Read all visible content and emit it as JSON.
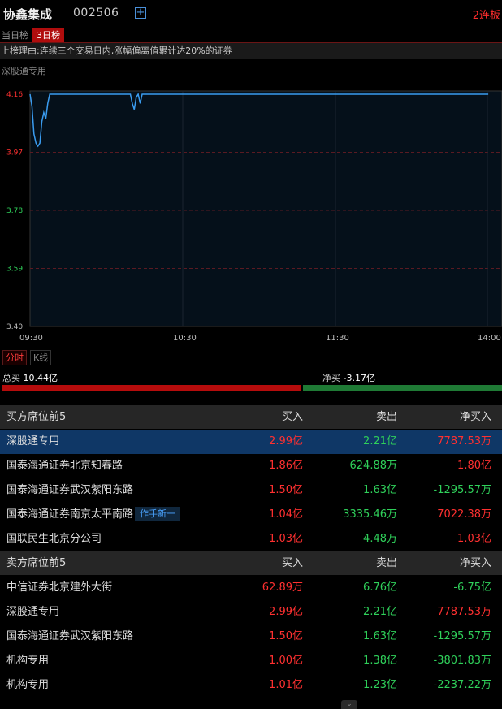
{
  "header": {
    "stock_name": "协鑫集成",
    "stock_code": "002506",
    "add_icon": "plus-square-icon",
    "streak": "2连板"
  },
  "tabs": [
    {
      "label": "当日榜",
      "active": false
    },
    {
      "label": "3日榜",
      "active": true
    }
  ],
  "reason": "上榜理由:连续三个交易日内,涨幅偏离值累计达20%的证券",
  "chart_title": "深股通专用",
  "chart_data": {
    "type": "line",
    "y_ticks": [
      "4.16",
      "3.97",
      "3.78",
      "3.59",
      "3.40"
    ],
    "x_ticks": [
      "09:30",
      "10:30",
      "11:30",
      "14:00"
    ],
    "ylim": [
      3.4,
      4.16
    ],
    "colors": {
      "line": "#3a9cf0",
      "upper": "#ff3030",
      "lower": "#2fd05a",
      "grid": "#5a1a22"
    },
    "series": [
      {
        "values": [
          4.16,
          4.12,
          4.03,
          4.0,
          3.99,
          4.0,
          4.07,
          4.1,
          4.08,
          4.13,
          4.16,
          4.16,
          4.16,
          4.16,
          4.16,
          4.16,
          4.16,
          4.16,
          4.16,
          4.16,
          4.16,
          4.16,
          4.16,
          4.16,
          4.16,
          4.16,
          4.16,
          4.16,
          4.16,
          4.16,
          4.16,
          4.16,
          4.16,
          4.16,
          4.16,
          4.16,
          4.16,
          4.16,
          4.16,
          4.16,
          4.16,
          4.16,
          4.16,
          4.16,
          4.16,
          4.16,
          4.16,
          4.16,
          4.16,
          4.16,
          4.16,
          4.16,
          4.13,
          4.11,
          4.15,
          4.16,
          4.13,
          4.16,
          4.16,
          4.16,
          4.16,
          4.16,
          4.16,
          4.16,
          4.16,
          4.16,
          4.16,
          4.16,
          4.16,
          4.16,
          4.16,
          4.16,
          4.16,
          4.16,
          4.16,
          4.16,
          4.16,
          4.16,
          4.16,
          4.16,
          4.16,
          4.16,
          4.16,
          4.16,
          4.16,
          4.16,
          4.16,
          4.16,
          4.16,
          4.16,
          4.16,
          4.16,
          4.16,
          4.16,
          4.16,
          4.16,
          4.16,
          4.16,
          4.16,
          4.16,
          4.16,
          4.16,
          4.16,
          4.16,
          4.16,
          4.16,
          4.16,
          4.16,
          4.16,
          4.16,
          4.16,
          4.16,
          4.16,
          4.16,
          4.16,
          4.16,
          4.16,
          4.16,
          4.16,
          4.16,
          4.16,
          4.16,
          4.16,
          4.16,
          4.16,
          4.16,
          4.16,
          4.16,
          4.16,
          4.16,
          4.16,
          4.16,
          4.16,
          4.16,
          4.16,
          4.16,
          4.16,
          4.16,
          4.16,
          4.16,
          4.16,
          4.16,
          4.16,
          4.16,
          4.16,
          4.16,
          4.16,
          4.16,
          4.16,
          4.16,
          4.16,
          4.16,
          4.16,
          4.16,
          4.16,
          4.16,
          4.16,
          4.16,
          4.16,
          4.16,
          4.16,
          4.16,
          4.16,
          4.16,
          4.16,
          4.16,
          4.16,
          4.16,
          4.16,
          4.16,
          4.16,
          4.16,
          4.16,
          4.16,
          4.16,
          4.16,
          4.16,
          4.16,
          4.16,
          4.16,
          4.16,
          4.16,
          4.16,
          4.16,
          4.16,
          4.16,
          4.16,
          4.16,
          4.16,
          4.16,
          4.16,
          4.16,
          4.16,
          4.16,
          4.16,
          4.16,
          4.16,
          4.16,
          4.16,
          4.16,
          4.16,
          4.16,
          4.16,
          4.16,
          4.16,
          4.16,
          4.16,
          4.16,
          4.16,
          4.16,
          4.16,
          4.16,
          4.16,
          4.16,
          4.16,
          4.16,
          4.16,
          4.16,
          4.16,
          4.16,
          4.16,
          4.16,
          4.16,
          4.16,
          4.16,
          4.16,
          4.16,
          4.16,
          4.16,
          4.16,
          4.16,
          4.16,
          4.16,
          4.16
        ]
      }
    ],
    "grid": true
  },
  "chart_modes": [
    {
      "label": "分时",
      "active": true
    },
    {
      "label": "K线",
      "active": false
    }
  ],
  "totals": {
    "buy_label": "总买",
    "buy_value": "10.44亿",
    "net_label": "净买",
    "net_value": "-3.17亿",
    "buy_ratio": 0.6,
    "colors": {
      "buy": "#b50c0c",
      "sell": "#1f7a35"
    }
  },
  "buyers": {
    "title": "买方席位前5",
    "columns": [
      "买入",
      "卖出",
      "净买入"
    ],
    "rows": [
      {
        "name": "深股通专用",
        "buy": "2.99亿",
        "sell": "2.21亿",
        "net": "7787.53万",
        "net_dir": "red",
        "highlight": true,
        "tag": ""
      },
      {
        "name": "国泰海通证券北京知春路",
        "buy": "1.86亿",
        "sell": "624.88万",
        "net": "1.80亿",
        "net_dir": "red",
        "highlight": false,
        "tag": ""
      },
      {
        "name": "国泰海通证券武汉紫阳东路",
        "buy": "1.50亿",
        "sell": "1.63亿",
        "net": "-1295.57万",
        "net_dir": "green",
        "highlight": false,
        "tag": ""
      },
      {
        "name": "国泰海通证券南京太平南路",
        "buy": "1.04亿",
        "sell": "3335.46万",
        "net": "7022.38万",
        "net_dir": "red",
        "highlight": false,
        "tag": "作手新一"
      },
      {
        "name": "国联民生北京分公司",
        "buy": "1.03亿",
        "sell": "4.48万",
        "net": "1.03亿",
        "net_dir": "red",
        "highlight": false,
        "tag": ""
      }
    ]
  },
  "sellers": {
    "title": "卖方席位前5",
    "columns": [
      "买入",
      "卖出",
      "净买入"
    ],
    "rows": [
      {
        "name": "中信证券北京建外大街",
        "buy": "62.89万",
        "sell": "6.76亿",
        "net": "-6.75亿",
        "net_dir": "green",
        "highlight": false,
        "tag": ""
      },
      {
        "name": "深股通专用",
        "buy": "2.99亿",
        "sell": "2.21亿",
        "net": "7787.53万",
        "net_dir": "red",
        "highlight": false,
        "tag": ""
      },
      {
        "name": "国泰海通证券武汉紫阳东路",
        "buy": "1.50亿",
        "sell": "1.63亿",
        "net": "-1295.57万",
        "net_dir": "green",
        "highlight": false,
        "tag": ""
      },
      {
        "name": "机构专用",
        "buy": "1.00亿",
        "sell": "1.38亿",
        "net": "-3801.83万",
        "net_dir": "green",
        "highlight": false,
        "tag": ""
      },
      {
        "name": "机构专用",
        "buy": "1.01亿",
        "sell": "1.23亿",
        "net": "-2237.22万",
        "net_dir": "green",
        "highlight": false,
        "tag": ""
      }
    ]
  },
  "scroll_icon": "chevron-down-icon"
}
